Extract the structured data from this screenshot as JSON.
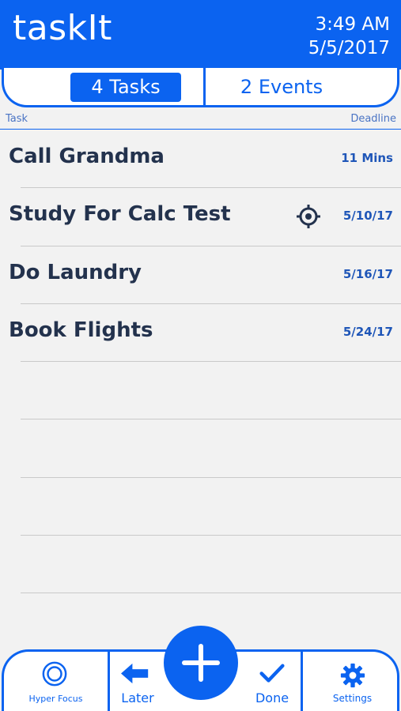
{
  "header": {
    "app_name": "taskIt",
    "time": "3:49 AM",
    "date": "5/5/2017"
  },
  "segments": {
    "tasks_label": "4 Tasks",
    "events_label": "2 Events",
    "selected": "tasks"
  },
  "columns": {
    "task": "Task",
    "deadline": "Deadline"
  },
  "tasks": [
    {
      "title": "Call Grandma",
      "deadline": "11 Mins",
      "hyper_focus": false
    },
    {
      "title": "Study For Calc Test",
      "deadline": "5/10/17",
      "hyper_focus": true
    },
    {
      "title": "Do Laundry",
      "deadline": "5/16/17",
      "hyper_focus": false
    },
    {
      "title": "Book Flights",
      "deadline": "5/24/17",
      "hyper_focus": false
    }
  ],
  "empty_rows": 5,
  "toolbar": {
    "hyper_focus": "Hyper Focus",
    "later": "Later",
    "done": "Done",
    "settings": "Settings"
  },
  "colors": {
    "accent": "#0b63f0",
    "text_dark": "#23324d",
    "background": "#f2f2f2"
  }
}
